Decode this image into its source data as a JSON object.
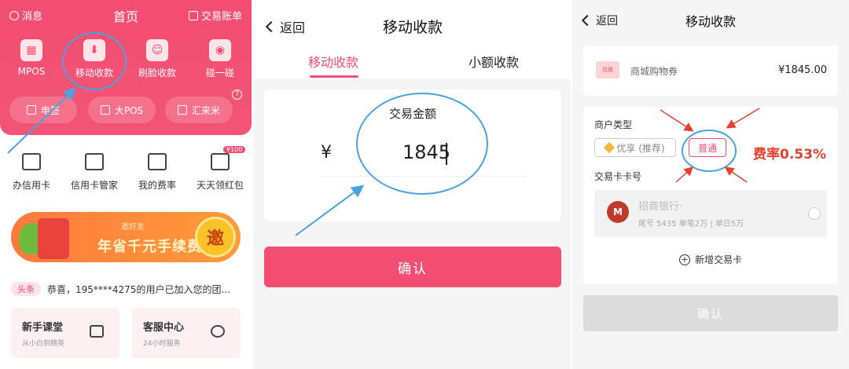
{
  "panel1": {
    "top": {
      "messages": "消息",
      "title": "首页",
      "bill": "交易账单"
    },
    "quick_actions": [
      {
        "label": "MPOS",
        "icon": "calculator-icon"
      },
      {
        "label": "移动收款",
        "icon": "download-icon"
      },
      {
        "label": "刷脸收款",
        "icon": "face-scan-icon"
      },
      {
        "label": "碰一碰",
        "icon": "nfc-icon"
      }
    ],
    "pills": [
      {
        "label": "电签",
        "icon": "terminal-icon"
      },
      {
        "label": "大POS",
        "icon": "pos-icon"
      },
      {
        "label": "汇来米",
        "icon": "scan-icon"
      }
    ],
    "services": [
      {
        "label": "办信用卡"
      },
      {
        "label": "信用卡管家"
      },
      {
        "label": "我的费率"
      },
      {
        "label": "天天领红包"
      }
    ],
    "badge": "¥100",
    "banner": {
      "invite": "邀好友",
      "slogan": "年省千元手续费",
      "button": "邀"
    },
    "news": {
      "tag": "头条",
      "text": "恭喜，195****4275的用户已加入您的团..."
    },
    "cards": [
      {
        "title": "新手课堂",
        "subtitle": "从小白到精英"
      },
      {
        "title": "客服中心",
        "subtitle": "24小时服务"
      }
    ],
    "highlight_color": "#f24d72"
  },
  "panel2": {
    "back": "返回",
    "title": "移动收款",
    "tabs": [
      {
        "label": "移动收款",
        "active": true
      },
      {
        "label": "小额收款",
        "active": false
      }
    ],
    "amount_label": "交易金额",
    "currency": "¥",
    "amount": "1845",
    "confirm": "确认"
  },
  "panel3": {
    "back": "返回",
    "title": "移动收款",
    "coupon": {
      "icon_text": "兑换",
      "name": "商城购物券",
      "price": "¥1845.00"
    },
    "merchant_type_label": "商户类型",
    "options": [
      {
        "label": "优享 (推荐)",
        "selected": false
      },
      {
        "label": "普通",
        "selected": true
      }
    ],
    "rate_note": "费率0.53%",
    "card_label": "交易卡卡号",
    "bank": {
      "logo": "M",
      "name": "招商银行·",
      "detail": "尾号 5435 单笔2万 | 单日5万"
    },
    "add_card": "新增交易卡",
    "confirm": "确认"
  }
}
